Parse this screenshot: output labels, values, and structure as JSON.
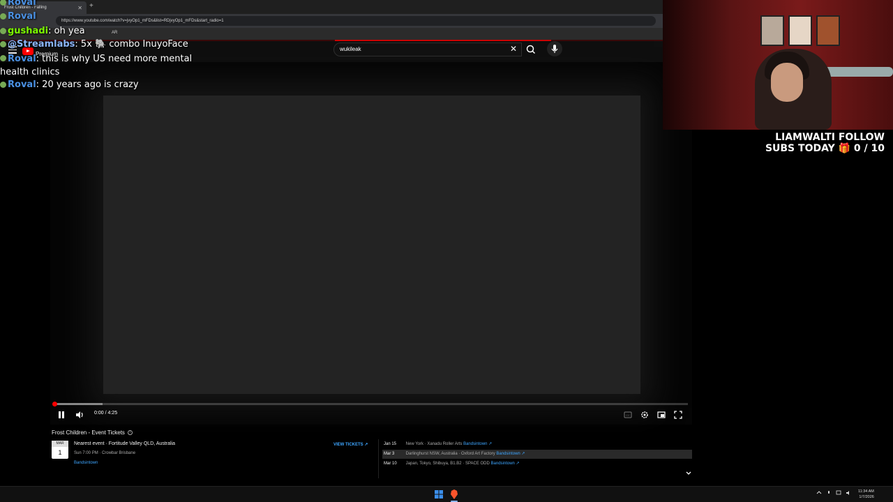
{
  "browser": {
    "tab_title": "Frost Children - Falling",
    "url": "https://www.youtube.com/watch?v=jvyOp1_mFDs&list=RDjvyOp1_mFDs&start_radio=1",
    "bookmark_label": "AR"
  },
  "youtube": {
    "logo_label": "Premium",
    "search_value": "wukileak"
  },
  "player": {
    "time": "0:00 / 4:25",
    "progress_fraction": 0,
    "buffered_fraction": 0.076
  },
  "events": {
    "title": "Frost Children - Event Tickets",
    "badge_month": "MAR",
    "badge_day": "1",
    "nearest_title": "Nearest event · Fortitude Valley QLD, Australia",
    "nearest_time": "Sun 7:00 PM · Crowbar Brisbane",
    "nearest_link": "Bandsintown",
    "view_tickets": "VIEW TICKETS ↗",
    "rows": [
      {
        "date": "Jan 15",
        "venue": "New York · Xanadu Roller Arts",
        "link": "Bandsintown ↗"
      },
      {
        "date": "Mar 3",
        "venue": "Darlinghurst NSW, Australia · Oxford Art Factory",
        "link": "Bandsintown ↗"
      },
      {
        "date": "Mar 10",
        "venue": "Japan, Tokyo, Shibuya, B1.B2 · SPACE ODD",
        "link": "Bandsintown ↗"
      }
    ]
  },
  "chat": [
    {
      "user": "Roval",
      "text": ""
    },
    {
      "user": "Roval",
      "text": ""
    },
    {
      "user": "gushadi",
      "text": "oh yea",
      "color": "#7CFC00"
    },
    {
      "user": "@Streamlabs",
      "text": "5x 🐘 combo InuyoFace",
      "color": "#8ab4f8"
    },
    {
      "user": "Roval",
      "text": "this is why US need more mental health clinics",
      "color": "#4a90e2"
    },
    {
      "user": "Roval",
      "text": "20 years ago is crazy",
      "color": "#4a90e2"
    }
  ],
  "overlay": {
    "follow_line1": "LIAMWALTI FOLLOW",
    "follow_line2": "SUBS TODAY 🎁 0 / 10"
  },
  "taskbar": {
    "time": "11:34 AM",
    "date": "1/7/2026"
  },
  "colors": {
    "youtube_red": "#ff0000",
    "link_blue": "#3ea6ff",
    "chat_user_blue": "#4a90e2",
    "chat_user_green": "#7CFC00"
  }
}
